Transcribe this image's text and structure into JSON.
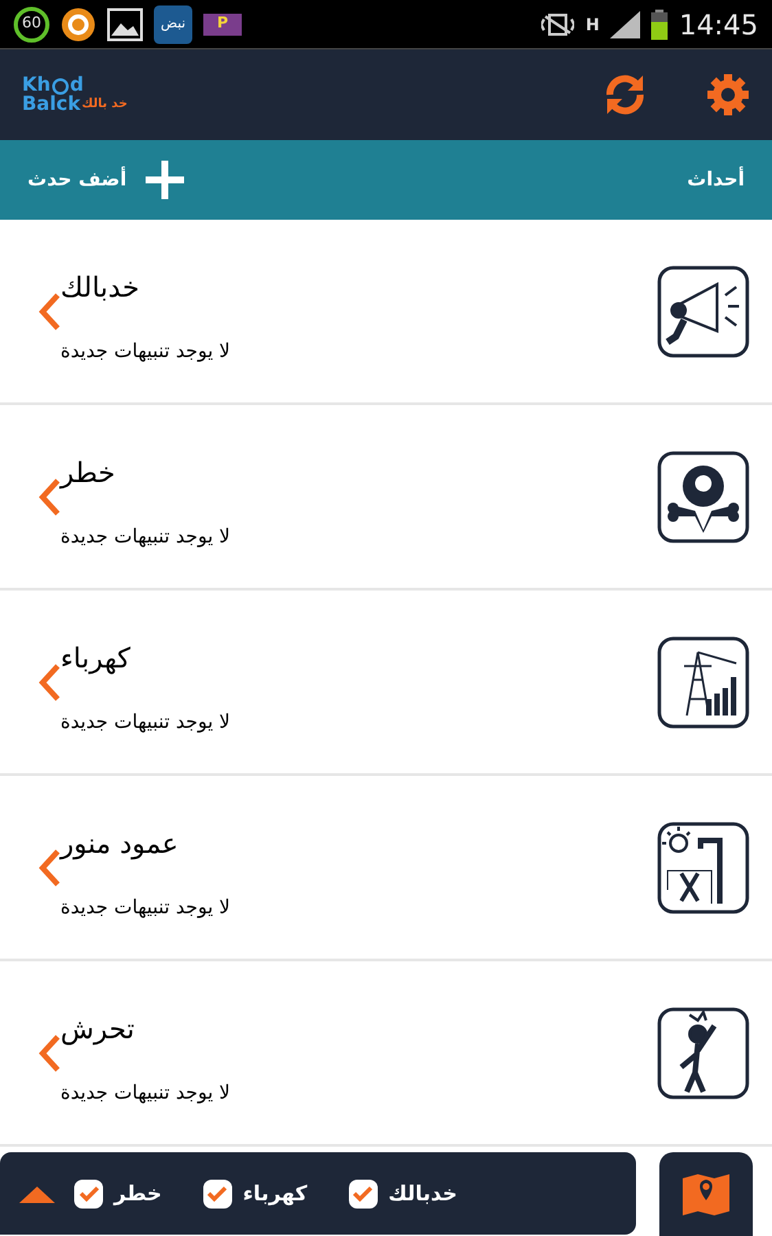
{
  "status_bar": {
    "battery_badge": "60",
    "news_app": "نبض",
    "parking_app": "P",
    "network": "H",
    "time": "14:45"
  },
  "app_bar": {
    "logo": {
      "top_left": "Kh",
      "top_right": "d",
      "bottom": "Balck",
      "arabic": "خد بالك"
    }
  },
  "section_bar": {
    "title": "أحداث",
    "add_label": "أضف حدث"
  },
  "events": [
    {
      "kind": "megaphone",
      "title": "خدبالك",
      "subtitle": "لا يوجد تنبيهات جديدة"
    },
    {
      "kind": "danger",
      "title": "خطر",
      "subtitle": "لا يوجد تنبيهات جديدة"
    },
    {
      "kind": "power",
      "title": "كهرباء",
      "subtitle": "لا يوجد تنبيهات جديدة"
    },
    {
      "kind": "streetlight",
      "title": "عمود منور",
      "subtitle": "لا يوجد تنبيهات جديدة"
    },
    {
      "kind": "harassment",
      "title": "تحرش",
      "subtitle": "لا يوجد تنبيهات جديدة"
    }
  ],
  "filters": [
    {
      "label": "خدبالك",
      "checked": true
    },
    {
      "label": "كهرباء",
      "checked": true
    },
    {
      "label": "خطر",
      "checked": true
    }
  ]
}
